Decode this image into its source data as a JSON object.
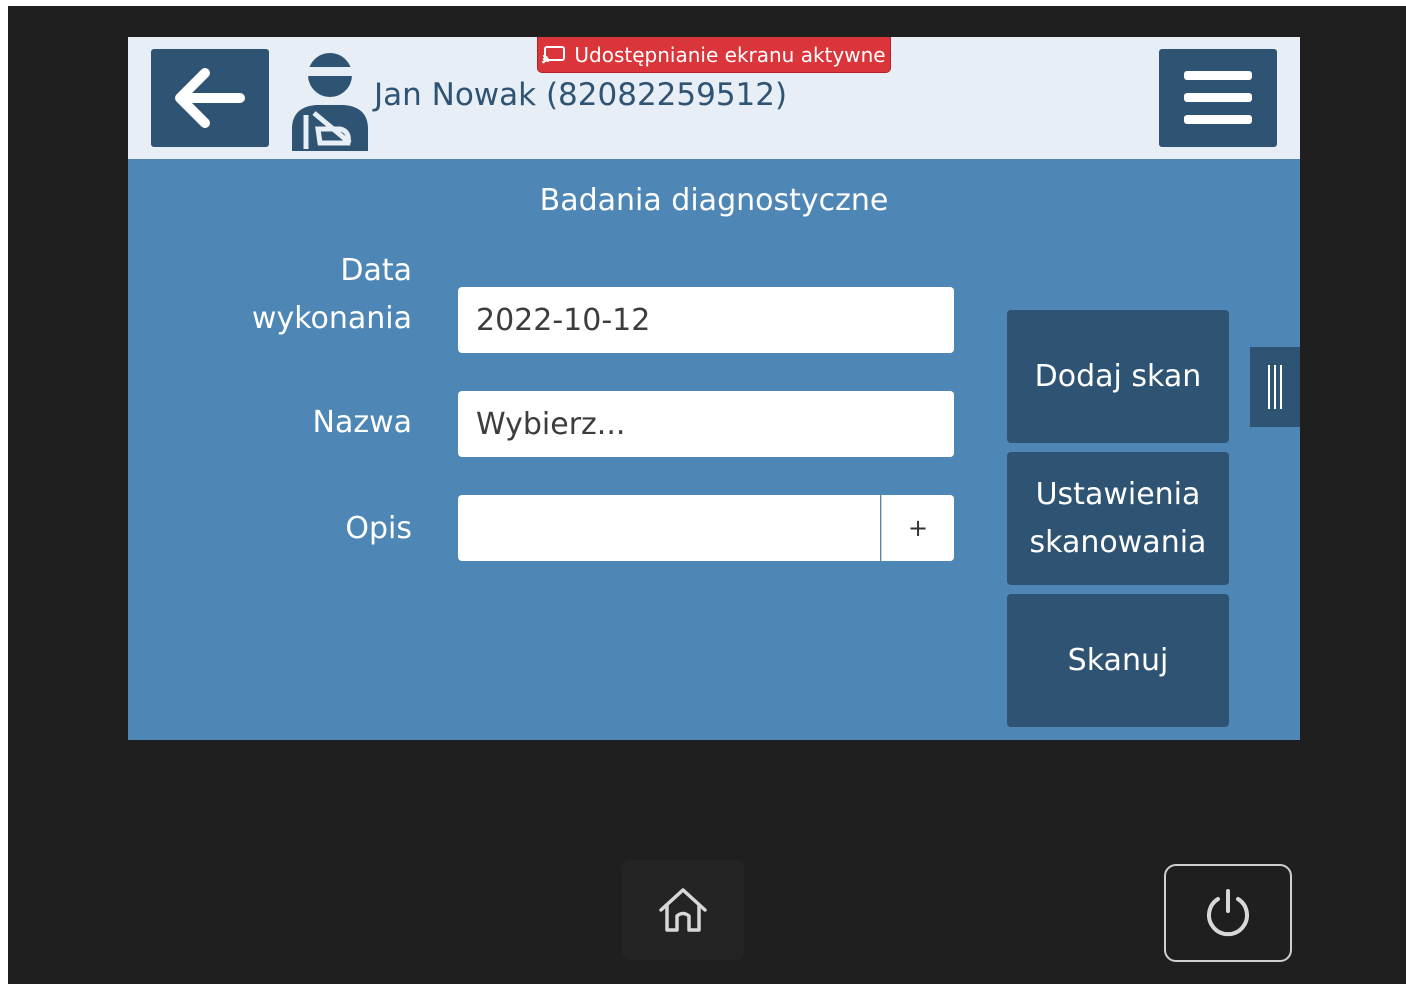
{
  "header": {
    "patient_name": "Jan Nowak (82082259512)",
    "share_banner": "Udostępnianie ekranu aktywne"
  },
  "section": {
    "title": "Badania diagnostyczne"
  },
  "form": {
    "date_label_line1": "Data",
    "date_label_line2": "wykonania",
    "date_value": "2022-10-12",
    "name_label": "Nazwa",
    "name_placeholder": "Wybierz...",
    "desc_label": "Opis",
    "desc_value": "",
    "plus_label": "+"
  },
  "actions": {
    "add_scan": "Dodaj skan",
    "scan_settings_line1": "Ustawienia",
    "scan_settings_line2": "skanowania",
    "scan": "Skanuj"
  },
  "icons": {
    "back": "arrow-left-icon",
    "patient": "injured-patient-icon",
    "menu": "hamburger-icon",
    "cast": "cast-icon",
    "drawer": "drawer-handle-icon",
    "home": "home-icon",
    "power": "power-icon"
  },
  "colors": {
    "screen_bg": "#4e87b5",
    "header_bg": "#e8eef5",
    "button_dark": "#2f5373",
    "banner_red": "#d9353a",
    "device_bg": "#1f1f1f"
  }
}
